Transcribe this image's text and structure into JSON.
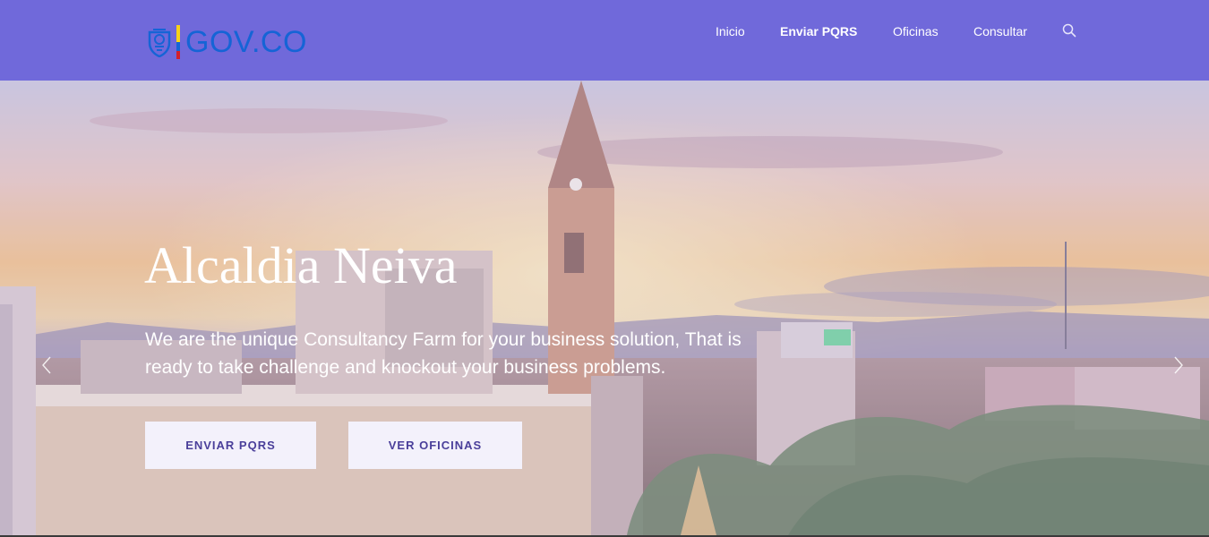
{
  "header": {
    "logo_text": "GOV.CO",
    "nav": [
      {
        "label": "Inicio",
        "active": false
      },
      {
        "label": "Enviar PQRS",
        "active": true
      },
      {
        "label": "Oficinas",
        "active": false
      },
      {
        "label": "Consultar",
        "active": false
      }
    ],
    "search_icon": "search-icon",
    "colors": {
      "background": "#7069da",
      "logo": "#1564d6"
    }
  },
  "hero": {
    "title": "Alcaldia Neiva",
    "subtitle": "We are the unique Consultancy Farm for your business solution, That is ready to take challenge and knockout your business problems.",
    "buttons": [
      {
        "label": "ENVIAR PQRS"
      },
      {
        "label": "VER OFICINAS"
      }
    ],
    "prev_icon": "chevron-left-icon",
    "next_icon": "chevron-right-icon"
  }
}
